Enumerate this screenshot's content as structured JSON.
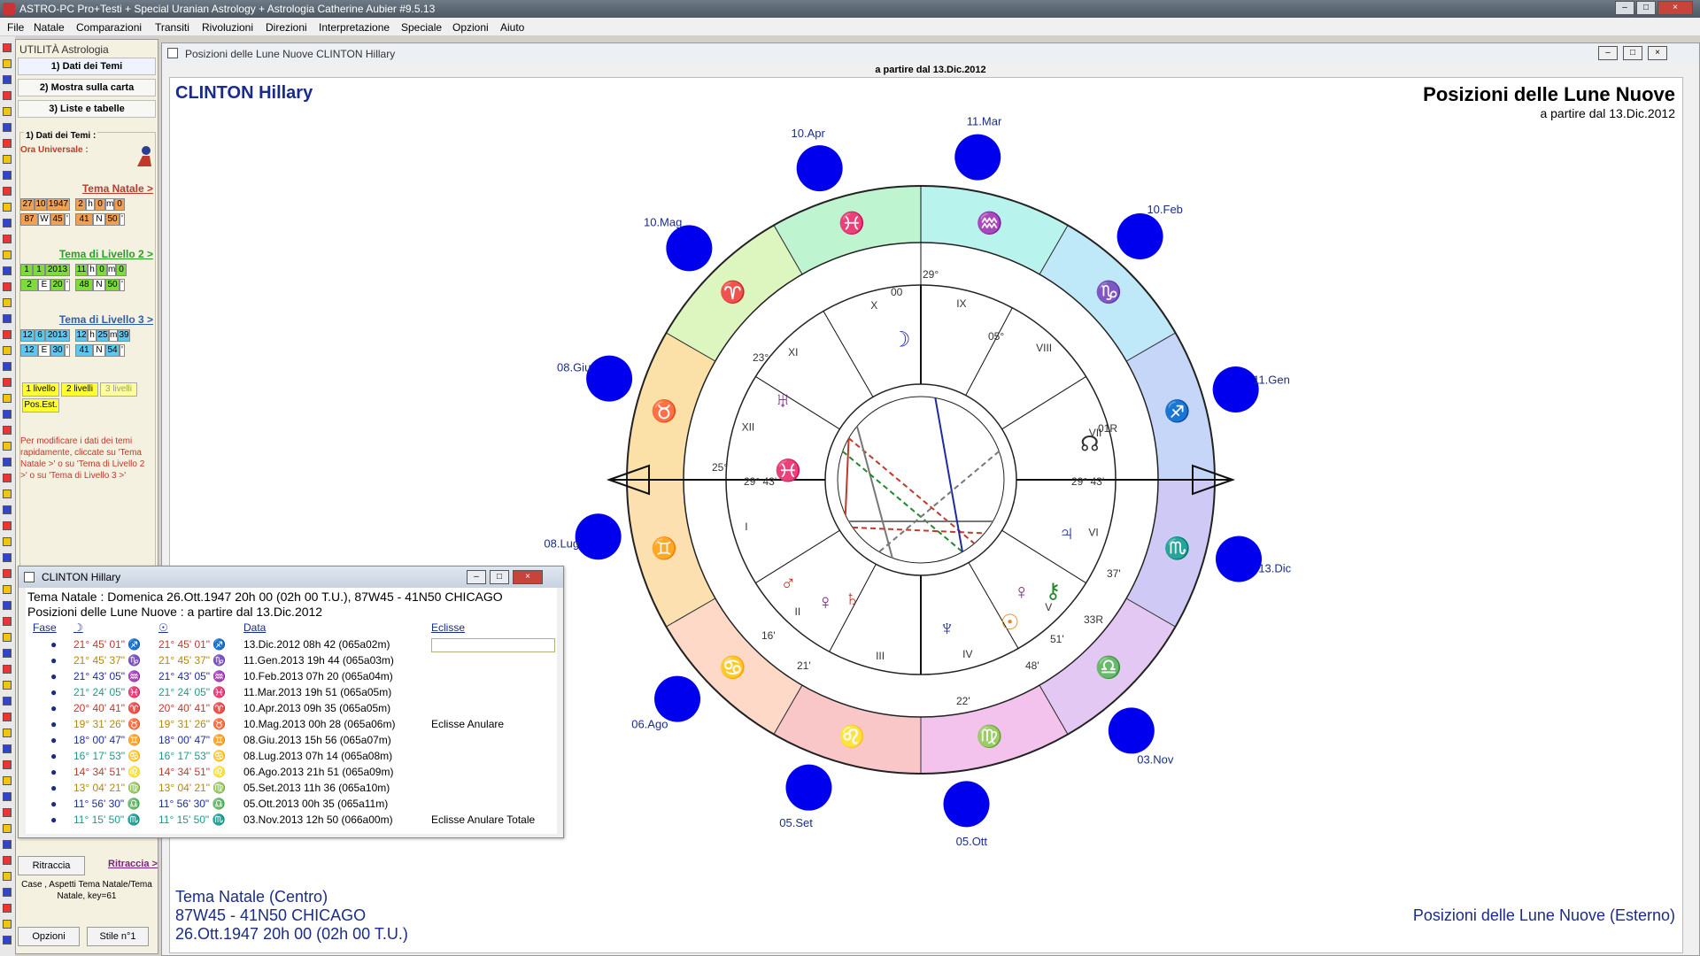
{
  "app": {
    "title": "ASTRO-PC Pro+Testi + Special Uranian Astrology + Astrologia Catherine Aubier #9.5.13",
    "controls": {
      "minimize": "–",
      "maximize": "□",
      "close": "×"
    }
  },
  "menu": [
    "File",
    "Natale",
    "Comparazioni",
    "Transiti",
    "Rivoluzioni",
    "Direzioni",
    "Interpretazione",
    "Speciale",
    "Opzioni",
    "Aiuto"
  ],
  "util": {
    "header": "UTILITÀ Astrologia",
    "tab1": "1) Dati dei Temi",
    "tab2": "2) Mostra sulla carta",
    "tab3": "3) Liste e tabelle",
    "group_title": "1) Dati dei Temi :",
    "ora_universale": "Ora Universale :",
    "natal_link": "Tema Natale >",
    "natal_row1": [
      "27",
      "10",
      "1947",
      "2",
      "h",
      "0",
      "m",
      "0"
    ],
    "natal_row2": [
      "87",
      "W",
      "45",
      "'",
      "41",
      "N",
      "50",
      "'"
    ],
    "lvl2_link": "Tema di Livello 2 >",
    "lvl2_row1": [
      "1",
      "1",
      "2013",
      "11",
      "h",
      "0",
      "m",
      "0"
    ],
    "lvl2_row2": [
      "2",
      "E",
      "20",
      "'",
      "48",
      "N",
      "50",
      "'"
    ],
    "lvl3_link": "Tema di Livello 3 >",
    "lvl3_row1": [
      "12",
      "6",
      "2013",
      "12",
      "h",
      "25",
      "m",
      "39"
    ],
    "lvl3_row2": [
      "12",
      "E",
      "30",
      "'",
      "41",
      "N",
      "54",
      "'"
    ],
    "btn_1livello": "1 livello",
    "btn_2livelli": "2 livelli",
    "btn_3livelli": "3 livelli",
    "btn_posest": "Pos.Est.",
    "help": "Per modificare i dati dei temi rapidamente, cliccate su 'Tema Natale >' o su 'Tema di Livello 2 >' o su 'Tema di Livello 3 >'",
    "ritraccia_btn": "Ritraccia",
    "ritraccia_link": "Ritraccia >",
    "status": "Case , Aspetti Tema Natale/Tema Natale, key=61",
    "opzioni_btn": "Opzioni",
    "stile_btn": "Stile n°1"
  },
  "chartwin": {
    "title": "Posizioni delle Lune Nuove  CLINTON Hillary",
    "subtitle_bar": "a partire dal 13.Dic.2012",
    "name": "CLINTON Hillary",
    "heading": "Posizioni delle Lune Nuove",
    "heading_sub": "a partire dal 13.Dic.2012",
    "footer_left1": "Tema Natale (Centro)",
    "footer_left2": "87W45 - 41N50  CHICAGO",
    "footer_left3": "26.Ott.1947 20h 00 (02h 00 T.U.)",
    "footer_right": "Posizioni delle Lune Nuove (Esterno)"
  },
  "moon_labels": [
    "13.Dic",
    "11.Gen",
    "10.Feb",
    "11.Mar",
    "10.Apr",
    "10.Mag",
    "08.Giu",
    "08.Lug",
    "06.Ago",
    "05.Set",
    "05.Ott",
    "03.Nov"
  ],
  "houses": [
    "I",
    "II",
    "III",
    "IV",
    "V",
    "VI",
    "VII",
    "VIII",
    "IX",
    "X",
    "XI",
    "XII"
  ],
  "chart_text": {
    "asc_left": "29° 43'",
    "asc_right": "29° 43'",
    "deg_29": "29°",
    "deg_23": "23°",
    "deg_25": "25°",
    "deg_05": "05°",
    "deg_00": "00",
    "deg_01r": "01R",
    "deg_33r": "33R",
    "deg_16": "16'",
    "deg_21": "21'",
    "deg_22": "22'",
    "deg_48": "48'",
    "deg_51": "51'",
    "deg_37": "37'"
  },
  "float": {
    "title": "CLINTON Hillary",
    "line1": "Tema Natale : Domenica 26.Ott.1947 20h 00 (02h 00 T.U.), 87W45 - 41N50  CHICAGO",
    "line2": "Posizioni delle Lune Nuove : a partire dal 13.Dic.2012",
    "col_fase": "Fase",
    "col_moon": "☽",
    "col_sun": "☉",
    "col_data": "Data",
    "col_eclisse": "Eclisse",
    "rows": [
      {
        "moon": "21° 45' 01\" ♐",
        "sun": "21° 45' 01\" ♐",
        "data": "13.Dic.2012 08h 42 (065a02m)",
        "ecl": "",
        "color": "#c0392b"
      },
      {
        "moon": "21° 45' 37\" ♑",
        "sun": "21° 45' 37\" ♑",
        "data": "11.Gen.2013 19h 44 (065a03m)",
        "ecl": "",
        "color": "#b8860b"
      },
      {
        "moon": "21° 43' 05\" ♒",
        "sun": "21° 43' 05\" ♒",
        "data": "10.Feb.2013 07h 20 (065a04m)",
        "ecl": "",
        "color": "#1f2ba0"
      },
      {
        "moon": "21° 24' 05\" ♓",
        "sun": "21° 24' 05\" ♓",
        "data": "11.Mar.2013 19h 51 (065a05m)",
        "ecl": "",
        "color": "#1b9c8c"
      },
      {
        "moon": "20° 40' 41\" ♈",
        "sun": "20° 40' 41\" ♈",
        "data": "10.Apr.2013 09h 35 (065a05m)",
        "ecl": "",
        "color": "#c0392b"
      },
      {
        "moon": "19° 31' 26\" ♉",
        "sun": "19° 31' 26\" ♉",
        "data": "10.Mag.2013 00h 28 (065a06m)",
        "ecl": "Eclisse Anulare",
        "color": "#b8860b"
      },
      {
        "moon": "18° 00' 47\" ♊",
        "sun": "18° 00' 47\" ♊",
        "data": "08.Giu.2013 15h 56 (065a07m)",
        "ecl": "",
        "color": "#1f2ba0"
      },
      {
        "moon": "16° 17' 53\" ♋",
        "sun": "16° 17' 53\" ♋",
        "data": "08.Lug.2013 07h 14 (065a08m)",
        "ecl": "",
        "color": "#1b9c8c"
      },
      {
        "moon": "14° 34' 51\" ♌",
        "sun": "14° 34' 51\" ♌",
        "data": "06.Ago.2013 21h 51 (065a09m)",
        "ecl": "",
        "color": "#c0392b"
      },
      {
        "moon": "13° 04' 21\" ♍",
        "sun": "13° 04' 21\" ♍",
        "data": "05.Set.2013 11h 36 (065a10m)",
        "ecl": "",
        "color": "#b8860b"
      },
      {
        "moon": "11° 56' 30\" ♎",
        "sun": "11° 56' 30\" ♎",
        "data": "05.Ott.2013 00h 35 (065a11m)",
        "ecl": "",
        "color": "#1f2ba0"
      },
      {
        "moon": "11° 15' 50\" ♏",
        "sun": "11° 15' 50\" ♏",
        "data": "03.Nov.2013 12h 50 (066a00m)",
        "ecl": "Eclisse Anulare Totale",
        "color": "#1b9c8c"
      }
    ]
  }
}
